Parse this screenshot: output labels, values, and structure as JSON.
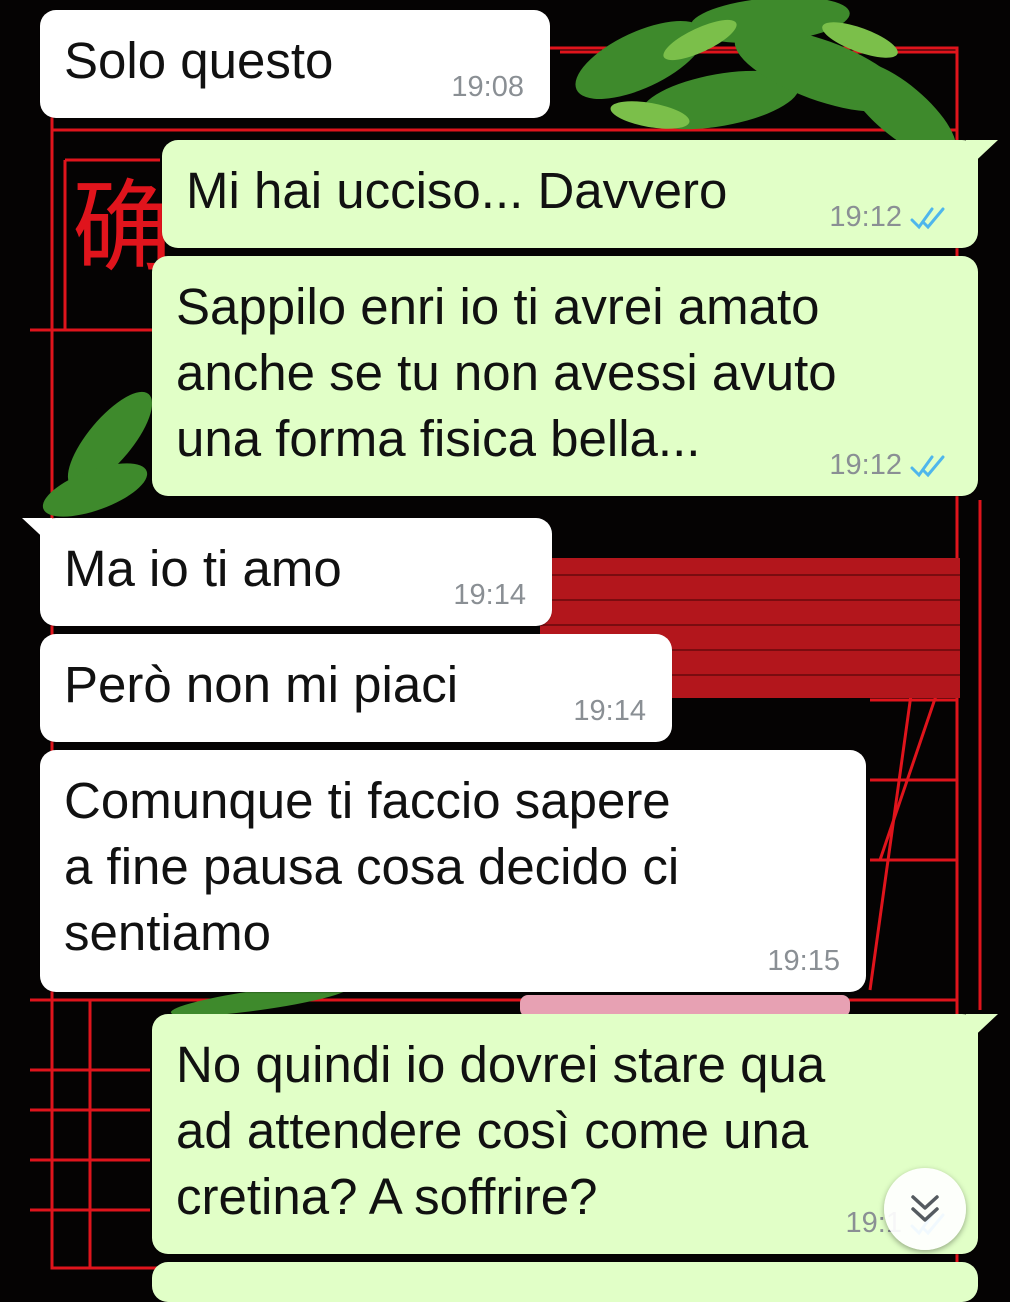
{
  "messages": [
    {
      "text": "Solo questo",
      "time": "19:08",
      "direction": "incoming"
    },
    {
      "text": "Mi hai ucciso... Davvero",
      "time": "19:12",
      "direction": "outgoing",
      "status": "read-double-tick"
    },
    {
      "text": "Sappilo enri io ti avrei amato\nanche se tu non avessi avuto\nuna forma fisica bella...",
      "time": "19:12",
      "direction": "outgoing",
      "status": "read-double-tick"
    },
    {
      "text": "Ma io ti amo",
      "time": "19:14",
      "direction": "incoming"
    },
    {
      "text": "Però non mi piaci",
      "time": "19:14",
      "direction": "incoming"
    },
    {
      "text": "Comunque ti faccio sapere\na fine pausa cosa decido ci\nsentiamo",
      "time": "19:15",
      "direction": "incoming"
    },
    {
      "text": "No quindi io dovrei stare qua\nad attendere così come una\ncretina? A soffrire?",
      "time": "19:1",
      "direction": "outgoing",
      "status": "read-double-tick"
    }
  ],
  "wallpaper": {
    "glyph": "确"
  },
  "controls": {
    "scroll_down_icon": "double-chevron-down-icon"
  },
  "colors": {
    "incoming_bubble": "#ffffff",
    "outgoing_bubble": "#e1ffc7",
    "timestamp": "#8a8f94",
    "read_ticks": "#4fb6ec",
    "wallpaper_lines": "#e0141c",
    "background": "#050303"
  }
}
